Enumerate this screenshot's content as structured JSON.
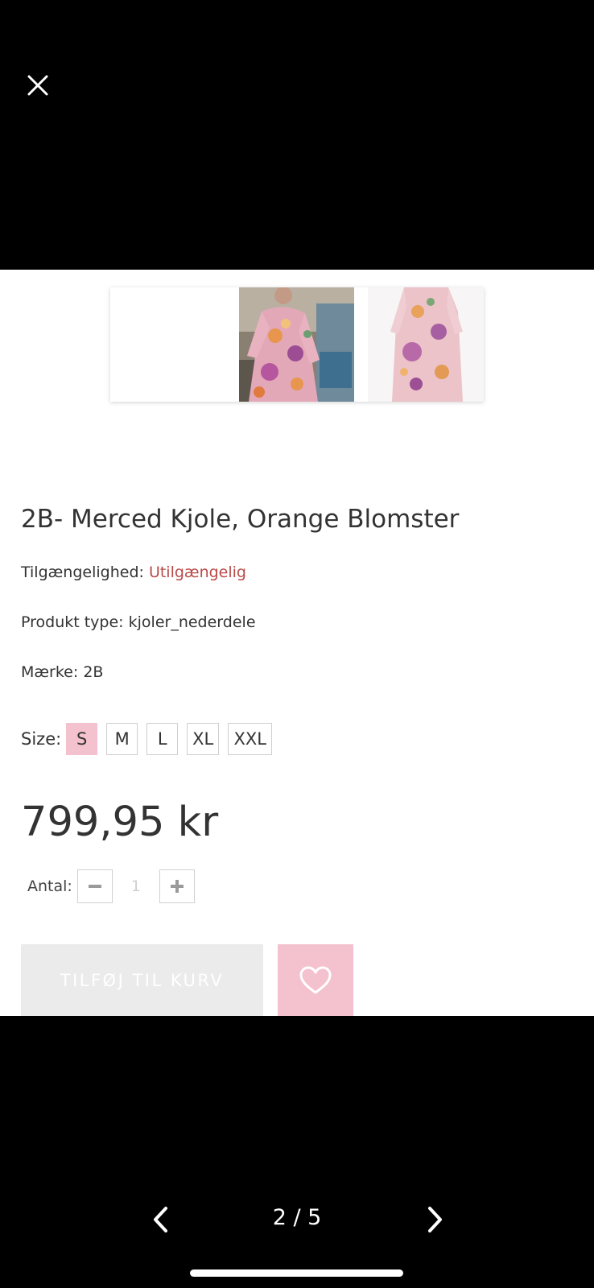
{
  "viewer": {
    "close_icon": "close-icon",
    "prev_icon": "chevron-left-icon",
    "next_icon": "chevron-right-icon",
    "pager": "2 / 5"
  },
  "gallery": {
    "thumbnails": [
      "blank",
      "model-wearing-floral-dress",
      "floral-dress-product"
    ]
  },
  "product": {
    "title": "2B- Merced Kjole, Orange Blomster",
    "availability_label": "Tilgængelighed:",
    "availability_value": "Utilgængelig",
    "type_label": "Produkt type:",
    "type_value": "kjoler_nederdele",
    "brand_label": "Mærke:",
    "brand_value": "2B",
    "size_label": "Size:",
    "sizes": [
      "S",
      "M",
      "L",
      "XL",
      "XXL"
    ],
    "selected_size": "S",
    "price": "799,95 kr",
    "quantity_label": "Antal:",
    "quantity_value": "1",
    "add_to_cart_label": "TILFØJ TIL KURV",
    "wishlist_icon": "heart-icon"
  },
  "colors": {
    "accent_pink": "#f4c1cf",
    "unavailable_red": "#b94a48",
    "disabled_button": "#ebebeb"
  }
}
